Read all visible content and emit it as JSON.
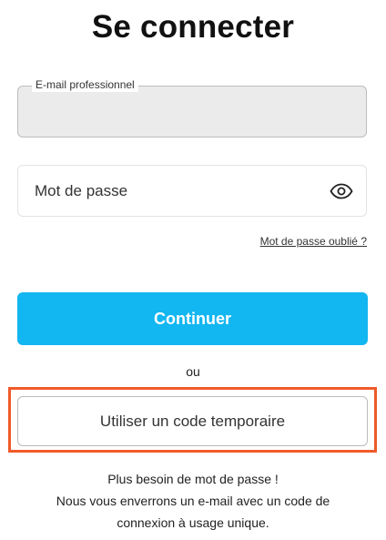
{
  "page": {
    "title": "Se connecter"
  },
  "email": {
    "label": "E-mail professionnel",
    "value": ""
  },
  "password": {
    "placeholder": "Mot de passe",
    "toggle_icon": "eye-icon"
  },
  "links": {
    "forgot_password": "Mot de passe oublié ?"
  },
  "buttons": {
    "continue": "Continuer",
    "temporary_code": "Utiliser un code temporaire"
  },
  "separator": {
    "or": "ou"
  },
  "info": {
    "line1": "Plus besoin de mot de passe !",
    "line2": "Nous vous enverrons un e-mail avec un code de",
    "line3": "connexion à usage unique."
  },
  "colors": {
    "primary": "#12b6f0",
    "highlight": "#f05a2a",
    "email_field_bg": "#ebebeb"
  }
}
